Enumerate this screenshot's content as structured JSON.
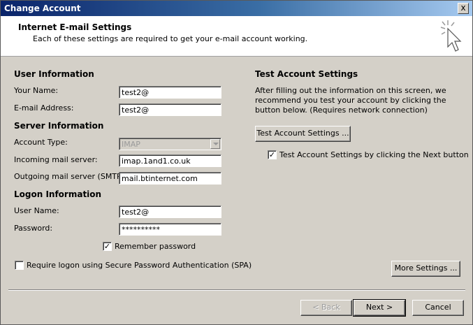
{
  "window": {
    "title": "Change Account",
    "close_label": "x"
  },
  "header": {
    "title": "Internet E-mail Settings",
    "subtitle": "Each of these settings are required to get your e-mail account working.",
    "icon": "wizard-cursor-icon"
  },
  "user_info": {
    "heading": "User Information",
    "name_label": "Your Name:",
    "name_value": "test2@",
    "email_label": "E-mail Address:",
    "email_value": "test2@"
  },
  "server_info": {
    "heading": "Server Information",
    "account_type_label": "Account Type:",
    "account_type_value": "IMAP",
    "incoming_label": "Incoming mail server:",
    "incoming_value": "imap.1and1.co.uk",
    "outgoing_label": "Outgoing mail server (SMTP):",
    "outgoing_value": "mail.btinternet.com"
  },
  "logon_info": {
    "heading": "Logon Information",
    "username_label": "User Name:",
    "username_value": "test2@",
    "password_label": "Password:",
    "password_value": "**********",
    "remember_label": "Remember password",
    "remember_checked": true,
    "spa_label": "Require logon using Secure Password Authentication (SPA)",
    "spa_checked": false
  },
  "test_settings": {
    "heading": "Test Account Settings",
    "description": "After filling out the information on this screen, we recommend you test your account by clicking the button below. (Requires network connection)",
    "test_button": "Test Account Settings ...",
    "next_check_label": "Test Account Settings by clicking the Next button",
    "next_check_checked": true
  },
  "more_settings_button": "More Settings ...",
  "footer": {
    "back": "< Back",
    "next": "Next >",
    "cancel": "Cancel"
  },
  "check_mark": "✓",
  "colors": {
    "title_start": "#0a246a",
    "title_end": "#a6caf0",
    "dialog_bg": "#d4d0c8"
  }
}
